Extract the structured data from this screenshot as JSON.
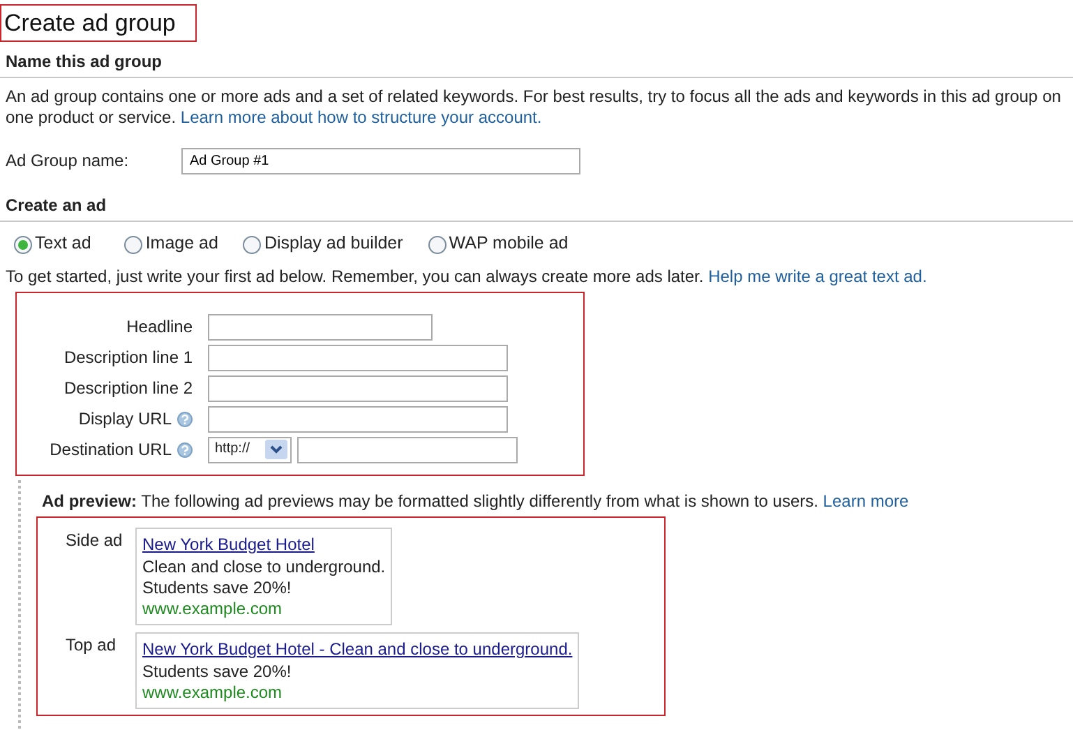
{
  "title": "Create ad group",
  "name_section": {
    "heading": "Name this ad group",
    "intro": "An ad group contains one or more ads and a set of related keywords. For best results, try to focus all the ads and keywords in this ad group on one product or service.",
    "intro_link": "Learn more about how to structure your account.",
    "name_label": "Ad Group name:",
    "name_value": "Ad Group #1"
  },
  "create_section": {
    "heading": "Create an ad",
    "ad_types": [
      {
        "label": "Text ad",
        "selected": true
      },
      {
        "label": "Image ad",
        "selected": false
      },
      {
        "label": "Display ad builder",
        "selected": false
      },
      {
        "label": "WAP mobile ad",
        "selected": false
      }
    ],
    "prompt": "To get started, just write your first ad below. Remember, you can always create more ads later.",
    "prompt_link": "Help me write a great text ad.",
    "fields": [
      {
        "label": "Headline",
        "kind": "short",
        "help": false
      },
      {
        "label": "Description line 1",
        "kind": "long",
        "help": false
      },
      {
        "label": "Description line 2",
        "kind": "long",
        "help": false
      },
      {
        "label": "Display URL",
        "kind": "long",
        "help": true
      },
      {
        "label": "Destination URL",
        "kind": "url",
        "protocol": "http://",
        "help": true
      }
    ]
  },
  "preview": {
    "text": "**Ad preview:** The following ad previews may be formatted slightly differently from what is shown to users.",
    "link": "Learn more",
    "ads": [
      {
        "label": "Side ad",
        "headline": "New York Budget Hotel",
        "lines": [
          "Clean and close to underground.",
          "Students save 20%!"
        ],
        "url": "www.example.com"
      },
      {
        "label": "Top ad",
        "headline": "New York Budget Hotel - Clean and close to underground.",
        "lines": [
          "Students save 20%!"
        ],
        "url": "www.example.com"
      }
    ]
  }
}
